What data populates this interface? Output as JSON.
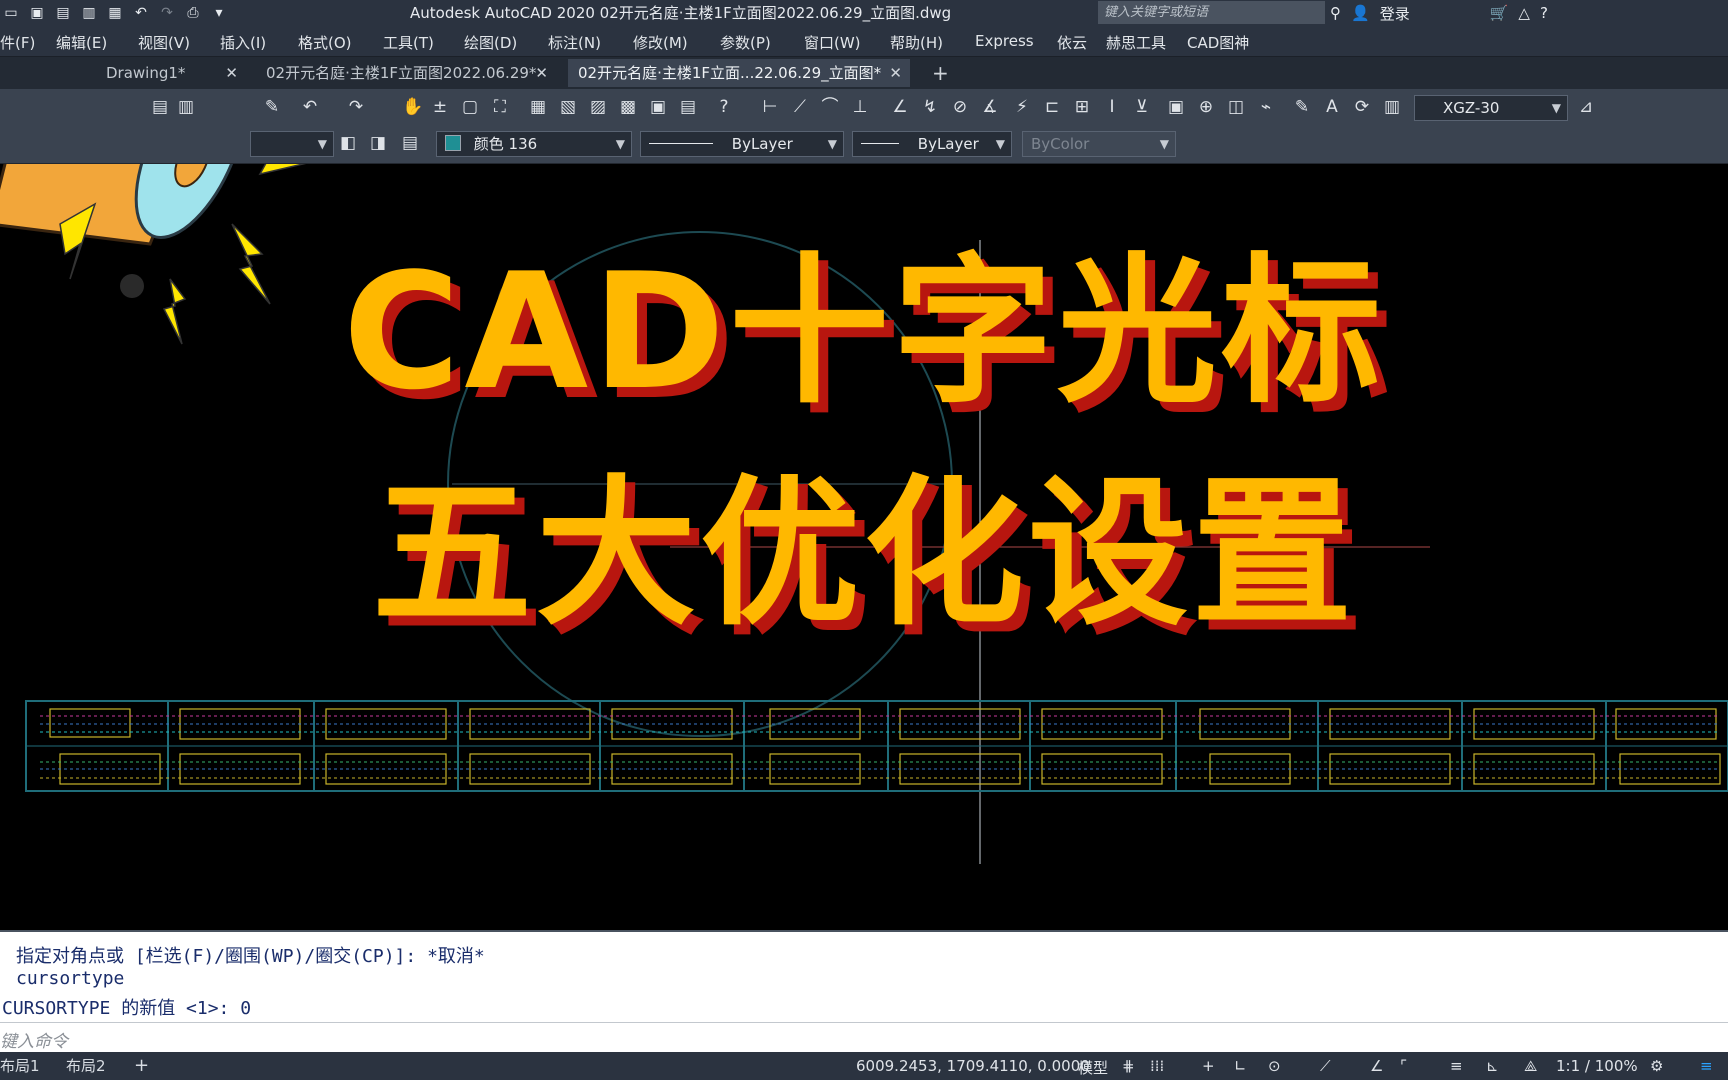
{
  "titlebar": {
    "app_title": "Autodesk AutoCAD 2020    02开元名庭·主楼1F立面图2022.06.29_立面图.dwg",
    "search_placeholder": "键入关键字或短语",
    "login_label": "登录"
  },
  "menu": [
    {
      "label": "件(F)"
    },
    {
      "label": "编辑(E)"
    },
    {
      "label": "视图(V)"
    },
    {
      "label": "插入(I)"
    },
    {
      "label": "格式(O)"
    },
    {
      "label": "工具(T)"
    },
    {
      "label": "绘图(D)"
    },
    {
      "label": "标注(N)"
    },
    {
      "label": "修改(M)"
    },
    {
      "label": "参数(P)"
    },
    {
      "label": "窗口(W)"
    },
    {
      "label": "帮助(H)"
    },
    {
      "label": "Express"
    },
    {
      "label": "依云"
    },
    {
      "label": "赫思工具"
    },
    {
      "label": "CAD图神"
    }
  ],
  "tabs": [
    {
      "label": "Drawing1*"
    },
    {
      "label": "02开元名庭·主楼1F立面图2022.06.29*"
    },
    {
      "label": "02开元名庭·主楼1F立面...22.06.29_立面图*"
    }
  ],
  "toolbar": {
    "text_style": "XGZ-30",
    "color": "颜色 136",
    "color_swatch": "#1f8f94",
    "linetype": "ByLayer",
    "lineweight": "ByLayer",
    "plotstyle": "ByColor"
  },
  "overlay": {
    "line1": "CAD十字光标",
    "line2": "五大优化设置",
    "text_color": "#ffb800",
    "shadow_color": "#b8160f"
  },
  "command": {
    "history": [
      "指定对角点或 [栏选(F)/圈围(WP)/圈交(CP)]: *取消*",
      "cursortype",
      "CURSORTYPE 的新值 <1>: 0"
    ],
    "input_placeholder": "键入命令"
  },
  "status": {
    "layout_tabs": [
      "布局1",
      "布局2"
    ],
    "coordinates": "6009.2453, 1709.4110, 0.0000",
    "mode_label": "模型",
    "scale": "1:1 / 100%"
  }
}
